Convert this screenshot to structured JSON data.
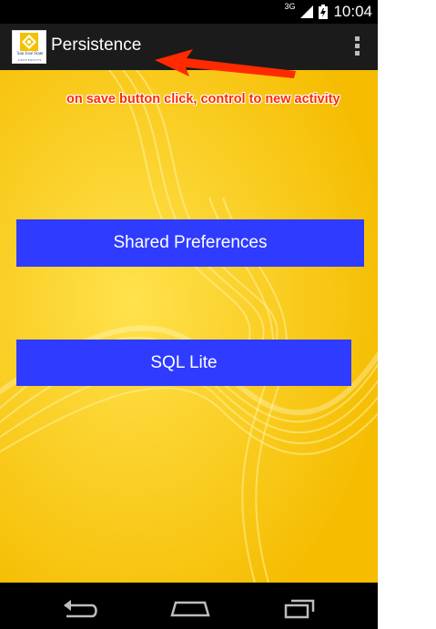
{
  "status_bar": {
    "network": "3G",
    "time": "10:04"
  },
  "action_bar": {
    "title": "Persistence",
    "logo_line1": "San José State",
    "logo_line2": "UNIVERSITY",
    "menu_icon": "overflow-menu-icon"
  },
  "main": {
    "background_color": "#ffd400",
    "buttons": [
      {
        "label": "Shared Preferences"
      },
      {
        "label": "SQL Lite"
      }
    ]
  },
  "annotation": {
    "text": "on save button click, control to new activity",
    "color": "#ff2a00"
  },
  "nav_bar": {
    "back_icon": "back-icon",
    "home_icon": "home-icon",
    "recents_icon": "recents-icon"
  }
}
